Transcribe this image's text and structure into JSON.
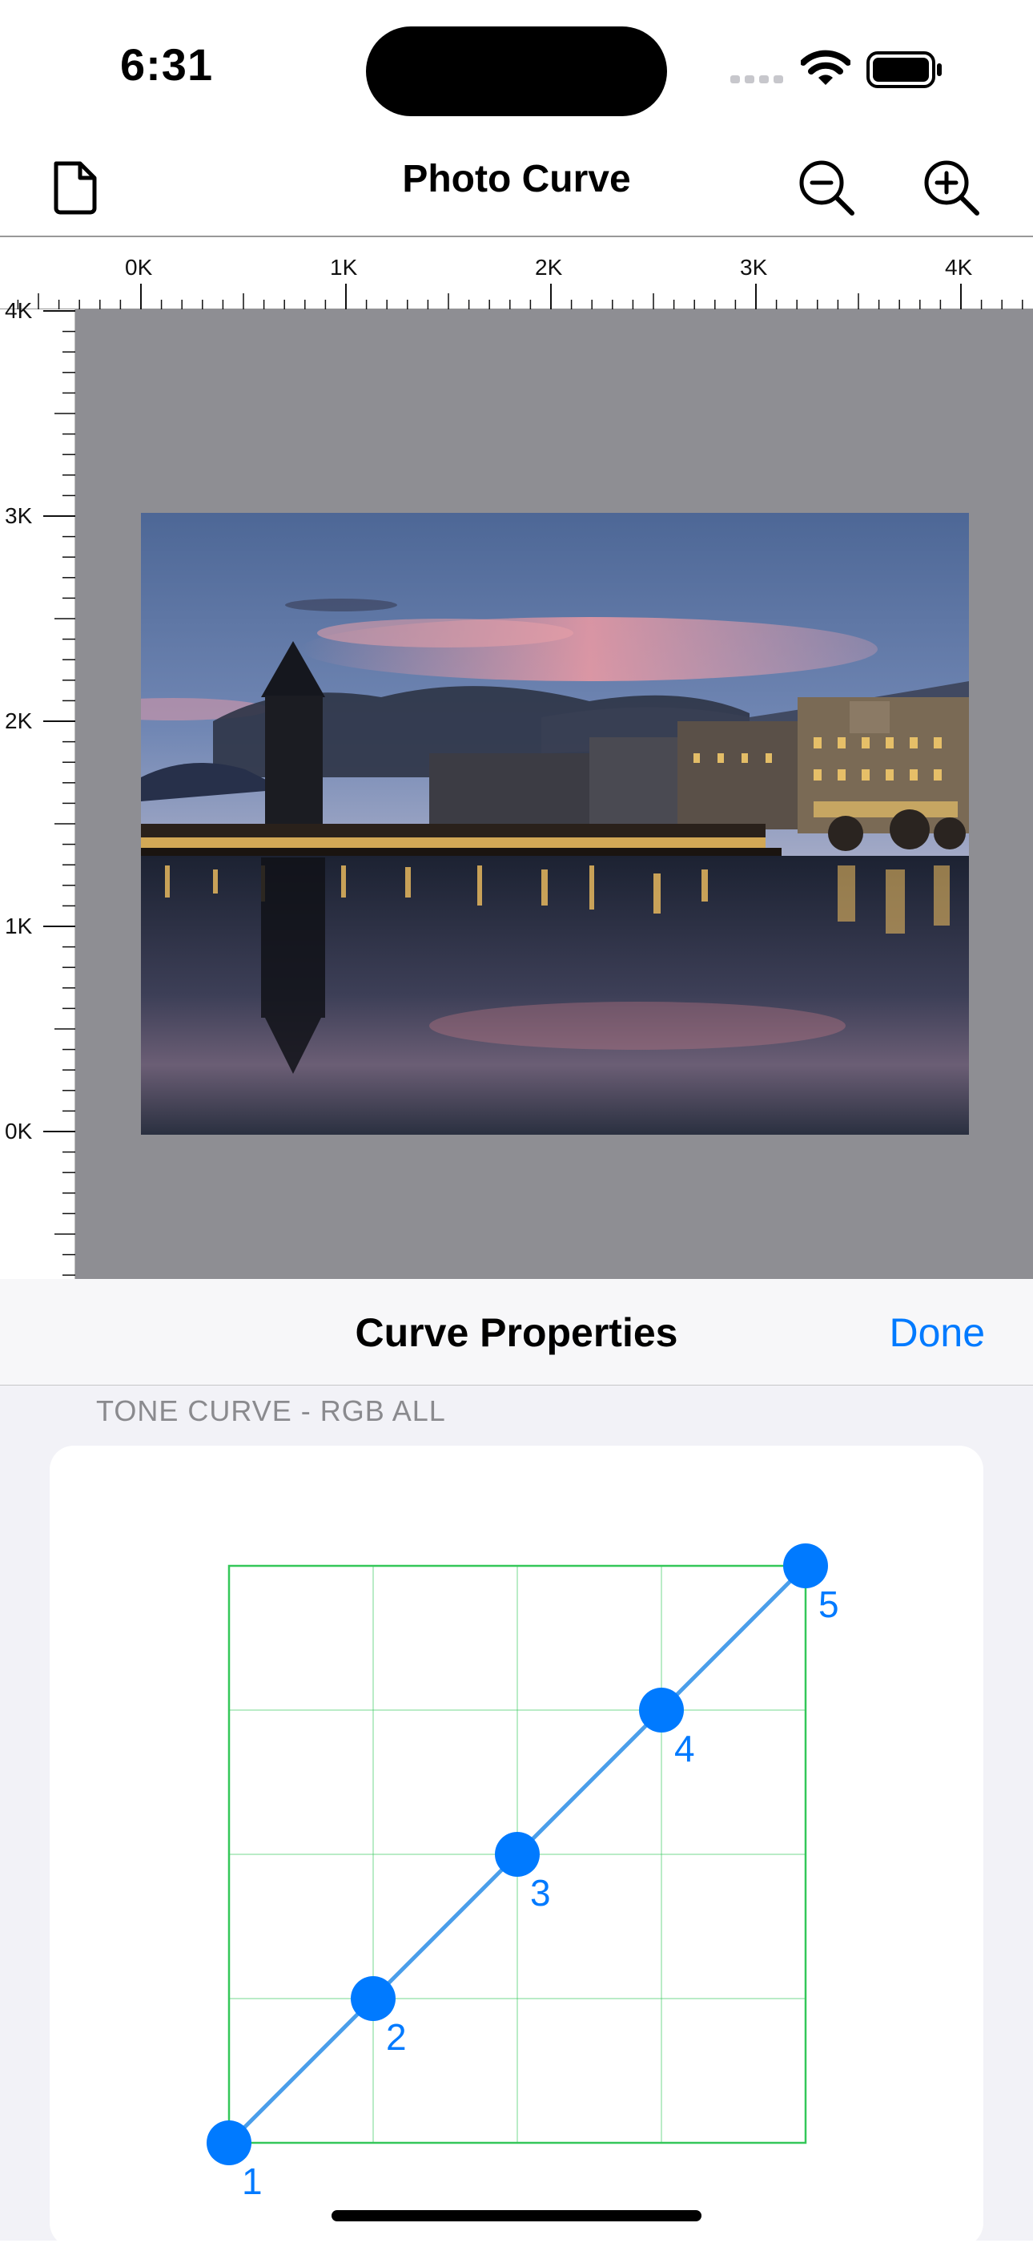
{
  "status_bar": {
    "time": "6:31"
  },
  "nav": {
    "title": "Photo Curve"
  },
  "ruler": {
    "horizontal_labels": [
      "0K",
      "1K",
      "2K",
      "3K",
      "4K"
    ],
    "vertical_labels": [
      "4K",
      "3K",
      "2K",
      "1K",
      "0K"
    ]
  },
  "sheet": {
    "title": "Curve Properties",
    "done_label": "Done",
    "section_header": "TONE CURVE - RGB ALL"
  },
  "curve": {
    "points": [
      {
        "label": "1",
        "x": 0,
        "y": 0
      },
      {
        "label": "2",
        "x": 0.25,
        "y": 0.25
      },
      {
        "label": "3",
        "x": 0.5,
        "y": 0.5
      },
      {
        "label": "4",
        "x": 0.75,
        "y": 0.75
      },
      {
        "label": "5",
        "x": 1,
        "y": 1
      }
    ],
    "grid_divisions": 4,
    "colors": {
      "grid": "#34c759",
      "line": "#4a9eea",
      "point": "#007aff"
    }
  },
  "colors": {
    "accent": "#007aff",
    "canvas_bg": "#8e8e93"
  }
}
